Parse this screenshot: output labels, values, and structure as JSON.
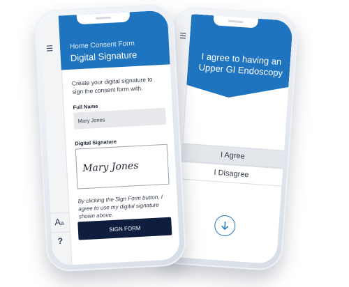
{
  "left_screen": {
    "menu_icon": "list-icon",
    "subtitle": "Home Consent Form",
    "title": "Digital Signature",
    "intro": "Create your digital signature to sign the consent form with.",
    "full_name_label": "Full Name",
    "full_name_value": "Mary Jones",
    "signature_label": "Digital Signature",
    "signature_value": "Mary Jones",
    "consent_text": "By clicking the Sign Form button, I agree to use my digital signature shown above.",
    "submit_label": "SIGN FORM",
    "font_size_icon": "font-size-icon",
    "help_icon": "question-icon",
    "font_glyph": "A",
    "font_glyph_small": "a",
    "help_glyph": "?"
  },
  "right_screen": {
    "menu_icon": "list-icon",
    "title": "I agree to having an Upper GI Endoscopy",
    "agree_label": "I Agree",
    "disagree_label": "I Disagree",
    "scroll_icon": "arrow-down-icon"
  },
  "colors": {
    "primary_blue": "#1f74c0",
    "navy_button": "#0f1d3f",
    "rail_gray": "#f3f4f6"
  }
}
